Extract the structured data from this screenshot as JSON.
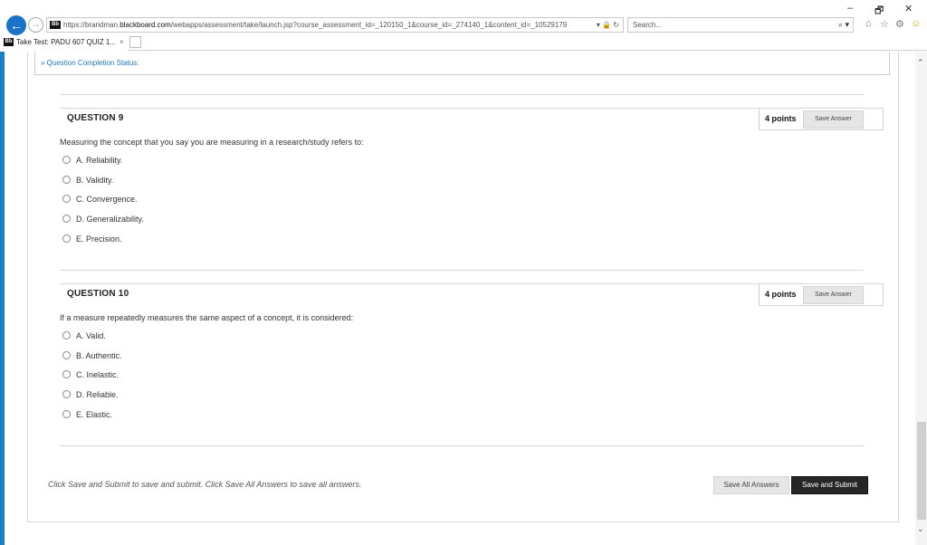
{
  "browser": {
    "url_prefix": "https://brandman.",
    "url_domain": "blackboard.com",
    "url_path": "/webapps/assessment/take/launch.jsp?course_assessment_id=_120150_1&course_id=_274140_1&content_id=_10529179",
    "url_tail": "▾ 🔒 ↻",
    "favicon_text": "Bb",
    "search_placeholder": "Search...",
    "search_icon": "⌕ ▾",
    "tab_title": "Take Test: PADU 607 QUIZ 1...",
    "tab_close": "×",
    "win_min": "–",
    "win_restore": "🗗",
    "win_close": "✕",
    "back_icon": "←",
    "fwd_icon": "→",
    "home_icon": "⌂",
    "star_icon": "☆",
    "gear_icon": "⚙",
    "smiley_icon": "☺"
  },
  "page": {
    "status_label": "» Question Completion Status:",
    "footer_text": "Click Save and Submit to save and submit. Click Save All Answers to save all answers.",
    "save_all_label": "Save All Answers",
    "submit_label": "Save and Submit",
    "scroll_up": "⌃",
    "scroll_down": "⌄"
  },
  "questions": [
    {
      "title": "QUESTION 9",
      "points": "4 points",
      "save_label": "Save Answer",
      "text": "Measuring the concept that you say you are measuring in a research/study refers to:",
      "options": [
        "A. Reliability.",
        "B. Validity.",
        "C. Convergence.",
        "D. Generalizability.",
        "E. Precision."
      ]
    },
    {
      "title": "QUESTION 10",
      "points": "4 points",
      "save_label": "Save Answer",
      "text": "If a measure repeatedly measures the same aspect of a concept, it is considered:",
      "options": [
        "A. Valid.",
        "B. Authentic.",
        "C. Inelastic.",
        "D. Reliable.",
        "E. Elastic."
      ]
    }
  ]
}
